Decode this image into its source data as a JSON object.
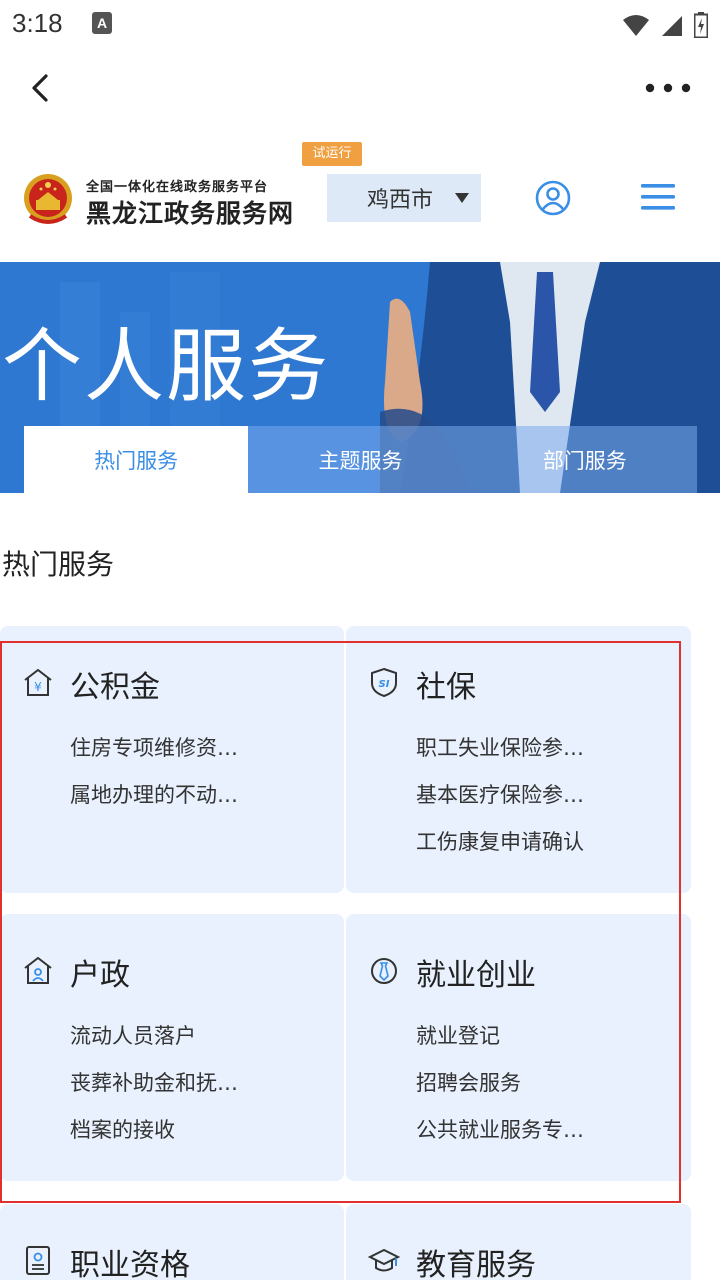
{
  "status_bar": {
    "time": "3:18",
    "notification_icon": "A"
  },
  "nav": {
    "back_icon": "chevron-left",
    "more_icon": "ellipsis-horizontal"
  },
  "header": {
    "subtitle": "全国一体化在线政务服务平台",
    "title": "黑龙江政务服务网",
    "trial_badge": "试运行",
    "city": "鸡西市",
    "user_icon": "user-circle",
    "menu_icon": "hamburger-menu"
  },
  "banner": {
    "title": "个人服务",
    "tabs": [
      {
        "label": "热门服务",
        "active": true
      },
      {
        "label": "主题服务",
        "active": false
      },
      {
        "label": "部门服务",
        "active": false
      }
    ]
  },
  "section": {
    "title": "热门服务"
  },
  "cards": [
    {
      "id": "gongjijin",
      "icon": "house-yen-icon",
      "title": "公积金",
      "items": [
        "住房专项维修资…",
        "属地办理的不动…"
      ]
    },
    {
      "id": "shebao",
      "icon": "shield-si-icon",
      "title": "社保",
      "items": [
        "职工失业保险参…",
        "基本医疗保险参…",
        "工伤康复申请确认"
      ]
    },
    {
      "id": "huzheng",
      "icon": "house-person-icon",
      "title": "户政",
      "items": [
        "流动人员落户",
        "丧葬补助金和抚…",
        "档案的接收"
      ]
    },
    {
      "id": "jiuye",
      "icon": "tie-circle-icon",
      "title": "就业创业",
      "items": [
        "就业登记",
        "招聘会服务",
        "公共就业服务专…"
      ]
    },
    {
      "id": "zhiye",
      "icon": "certificate-icon",
      "title": "职业资格",
      "items": []
    },
    {
      "id": "jiaoyu",
      "icon": "graduation-cap-icon",
      "title": "教育服务",
      "items": []
    }
  ],
  "colors": {
    "accent": "#3a8ee6",
    "banner": "#2f78d2",
    "card_bg": "#e8f1fd",
    "trial_badge": "#f0a040",
    "highlight": "#e03030"
  }
}
